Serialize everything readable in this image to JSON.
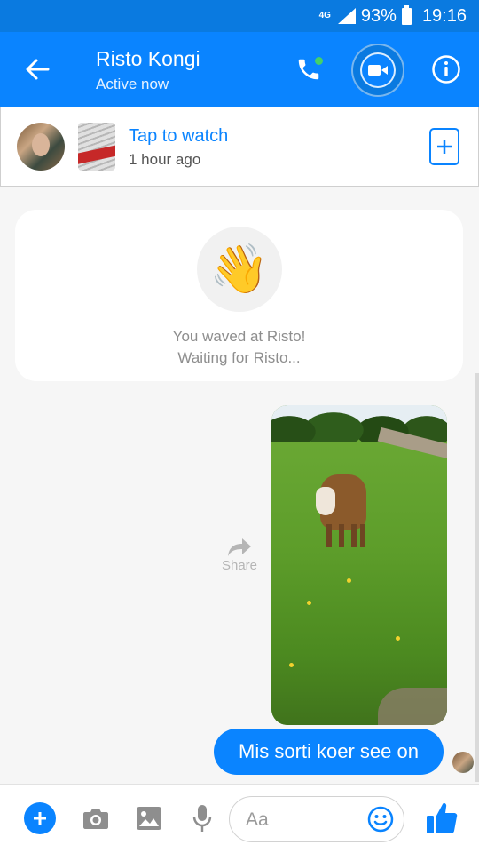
{
  "status_bar": {
    "network": "4G",
    "battery": "93%",
    "time": "19:16"
  },
  "header": {
    "title": "Risto Kongi",
    "subtitle": "Active now"
  },
  "story": {
    "title": "Tap to watch",
    "time": "1 hour ago"
  },
  "wave_card": {
    "line1": "You waved at Risto!",
    "line2": "Waiting for Risto...",
    "emoji": "👋"
  },
  "photo_message": {
    "share_label": "Share"
  },
  "text_message": {
    "text": "Mis sorti koer see on"
  },
  "composer": {
    "placeholder": "Aa"
  },
  "colors": {
    "accent": "#0a84ff",
    "header": "#0a84ff",
    "online": "#44d06a"
  }
}
